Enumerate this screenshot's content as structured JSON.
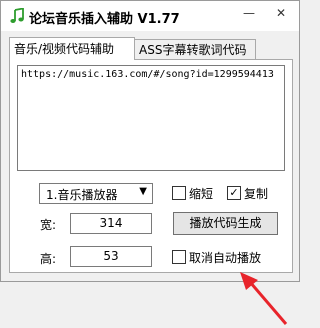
{
  "window": {
    "title": "论坛音乐插入辅助 V1.77",
    "minimize_icon": "minimize-icon",
    "close_icon": "close-icon"
  },
  "tabs": [
    {
      "label": "音乐/视频代码辅助",
      "active": true
    },
    {
      "label": "ASS字幕转歌词代码",
      "active": false
    }
  ],
  "url_input": {
    "value": "https://music.163.com/#/song?id=1299594413"
  },
  "player_select": {
    "selected": "1.音乐播放器"
  },
  "checkboxes": {
    "shrink": {
      "label": "缩短",
      "checked": false
    },
    "copy": {
      "label": "复制",
      "checked": true
    },
    "cancel_autoplay": {
      "label": "取消自动播放",
      "checked": false
    }
  },
  "width": {
    "label": "宽:",
    "value": "314"
  },
  "height": {
    "label": "高:",
    "value": "53"
  },
  "generate_button": {
    "label": "播放代码生成"
  },
  "colors": {
    "annotation_arrow": "#e8242b"
  }
}
